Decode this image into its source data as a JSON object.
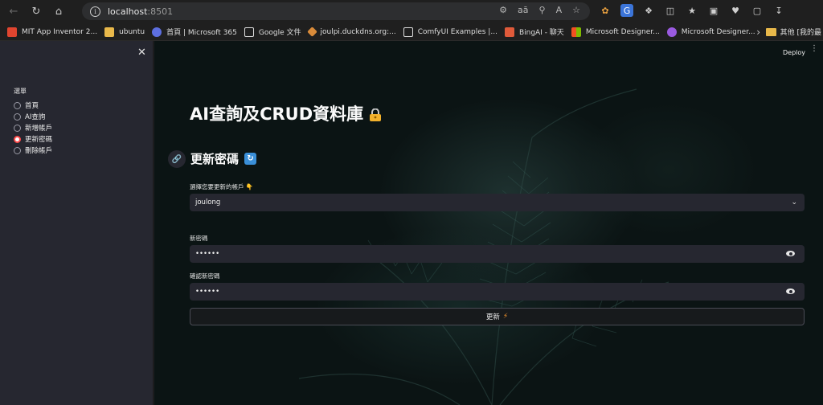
{
  "browser": {
    "url_host": "localhost",
    "url_port": ":8501",
    "bookmarks": [
      {
        "label": "MIT App Inventor 2...",
        "color": "#e0452f"
      },
      {
        "label": "ubuntu",
        "color": "#e8b84a"
      },
      {
        "label": "首頁 | Microsoft 365",
        "color": "#5d6fe0"
      },
      {
        "label": "Google 文件",
        "color": "#dcdcdc"
      },
      {
        "label": "joulpi.duckdns.org:...",
        "color": "#d98b3a"
      },
      {
        "label": "ComfyUI Examples |...",
        "color": "#dcdcdc"
      },
      {
        "label": "BingAI - 聊天",
        "color": "#e05a3a"
      },
      {
        "label": "Microsoft Designer...",
        "color": "#3ea0e0"
      },
      {
        "label": "Microsoft Designer...",
        "color": "#9a5ae0"
      }
    ],
    "other_bookmarks": "其他 [我的最"
  },
  "sidebar": {
    "menu_label": "選單",
    "items": [
      {
        "label": "首頁",
        "selected": false
      },
      {
        "label": "AI查詢",
        "selected": false
      },
      {
        "label": "新增帳戶",
        "selected": false
      },
      {
        "label": "更新密碼",
        "selected": true
      },
      {
        "label": "刪除帳戶",
        "selected": false
      }
    ]
  },
  "header": {
    "deploy_label": "Deploy"
  },
  "main": {
    "title": "AI查詢及CRUD資料庫",
    "subheader": "更新密碼",
    "account_label": "選擇您要更新的帳戶 👇",
    "account_value": "joulong",
    "new_password_label": "新密碼",
    "new_password_value": "••••••",
    "confirm_password_label": "確認新密碼",
    "confirm_password_value": "••••••",
    "submit_label": "更新"
  },
  "colors": {
    "accent": "#ff4b4b",
    "sidebar_bg": "#262730",
    "input_bg": "#262730"
  }
}
